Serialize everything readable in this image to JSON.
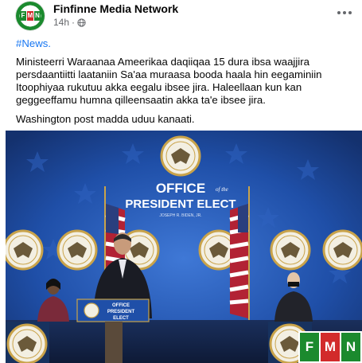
{
  "page": {
    "name": "Finfinne Media Network",
    "time": "14h",
    "privacy_icon": "globe-icon",
    "more_icon": "more-options-icon"
  },
  "avatar": {
    "letters": [
      "F",
      "M",
      "N"
    ],
    "colors": [
      "#1b8a2e",
      "#d22b2b",
      "#1b8a2e"
    ]
  },
  "post": {
    "hashtag": "#News.",
    "paragraph_1": "Ministeerri Waraanaa Ameerikaa daqiiqaa 15 dura ibsa waajjira persdaantiitti laataniin Sa'aa muraasa booda haala hin eegaminiin Itoophiyaa rukutuu akka eegalu ibsee jira. Haleellaan kun kan geggeeffamu humna qilleensaatin akka ta'e ibsee jira.",
    "paragraph_2": "Washington post madda uduu kanaati."
  },
  "photo": {
    "backdrop_line_1": "OFFICE",
    "backdrop_of_the": "of the",
    "backdrop_line_2": "PRESIDENT ELECT",
    "backdrop_name": "JOSEPH R. BIDEN, JR.",
    "podium_line_1": "OFFICE",
    "podium_line_2": "PRESIDENT",
    "podium_line_3": "ELECT",
    "watermark": [
      "F",
      "M",
      "N"
    ],
    "colors": {
      "backdrop": "#1f4fa8",
      "seal_gold": "#c9a34a"
    }
  }
}
